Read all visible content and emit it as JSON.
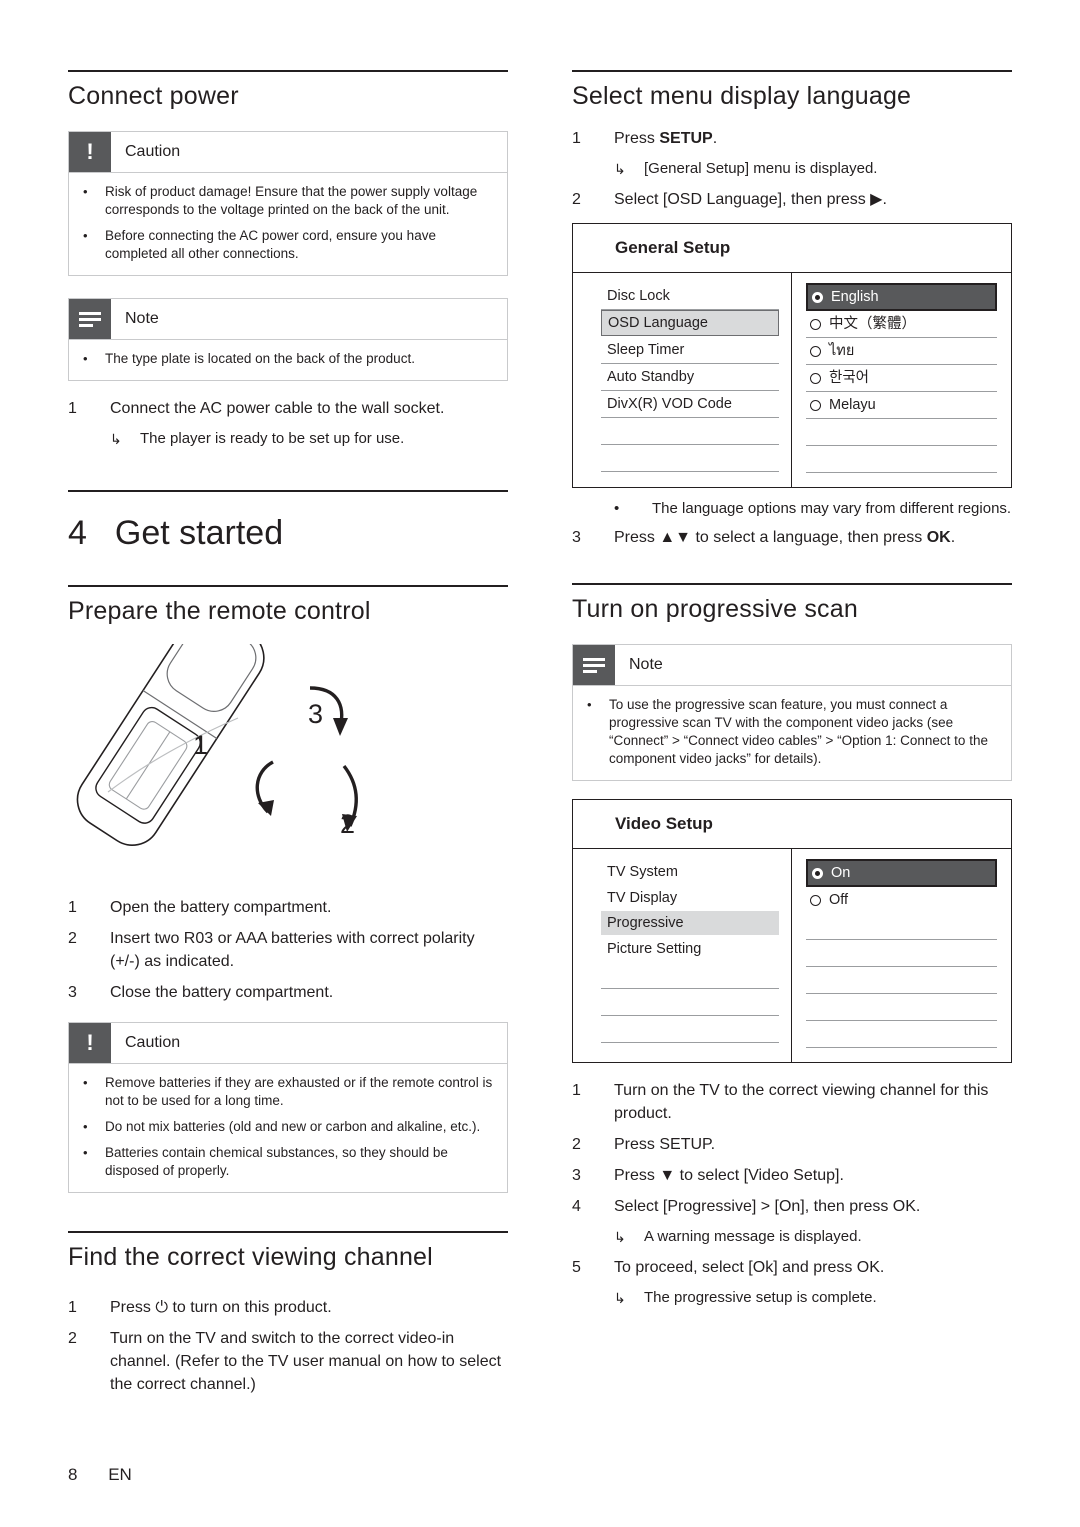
{
  "left": {
    "connect_power": {
      "title": "Connect power",
      "caution": {
        "label": "Caution",
        "bullets": [
          "Risk of product damage! Ensure that the power supply voltage corresponds to the voltage printed on the back of the unit.",
          "Before connecting the AC power cord, ensure you have completed all other connections."
        ]
      },
      "note": {
        "label": "Note",
        "bullets": [
          "The type plate is located on the back of the product."
        ]
      },
      "steps": [
        {
          "n": "1",
          "t": "Connect the AC power cable to the wall socket."
        }
      ],
      "substep": "The player is ready to be set up for use."
    },
    "chapter": {
      "num": "4",
      "title": "Get started"
    },
    "remote": {
      "title": "Prepare the remote control",
      "callouts": [
        "1",
        "2",
        "3"
      ],
      "steps": [
        {
          "n": "1",
          "t": "Open the battery compartment."
        },
        {
          "n": "2",
          "t": "Insert two R03 or AAA batteries with correct polarity (+/-) as indicated."
        },
        {
          "n": "3",
          "t": "Close the battery compartment."
        }
      ],
      "caution": {
        "label": "Caution",
        "bullets": [
          "Remove batteries if they are exhausted or if the remote control is not to be used for a long time.",
          "Do not mix batteries (old and new or carbon and alkaline, etc.).",
          "Batteries contain chemical substances, so they should be disposed of properly."
        ]
      }
    },
    "find_channel": {
      "title": "Find the correct viewing channel",
      "steps": [
        {
          "n": "1",
          "t": "Press ⏻ to turn on this product."
        },
        {
          "n": "2",
          "t": "Turn on the TV and switch to the correct video-in channel. (Refer to the TV user manual on how to select the correct channel.)"
        }
      ]
    }
  },
  "right": {
    "menu_lang": {
      "title": "Select menu display language",
      "step1_pre": "Press ",
      "step1_kw": "SETUP",
      "step1_post": ".",
      "sub1": "[General Setup] menu is displayed.",
      "step2": "Select [OSD Language], then press ▶.",
      "osd": {
        "title": "General Setup",
        "left_items": [
          "Disc Lock",
          "OSD Language",
          "Sleep Timer",
          "Auto Standby",
          "DivX(R) VOD Code"
        ],
        "left_selected_index": 1,
        "right_options": [
          "English",
          "中文（繁體）",
          "ไทย",
          "한국어",
          "Melayu"
        ],
        "right_selected_index": 0
      },
      "note_bullet": "The language options may vary from different regions.",
      "step3_pre": "Press ▲▼ to select a language, then press ",
      "step3_kw": "OK",
      "step3_post": "."
    },
    "progressive": {
      "title": "Turn on progressive scan",
      "note": {
        "label": "Note",
        "bullets": [
          "To use the progressive scan feature, you must connect a progressive scan TV with the component video jacks (see “Connect” > “Connect video cables” > “Option 1: Connect to the component video jacks” for details)."
        ]
      },
      "osd": {
        "title": "Video Setup",
        "left_items": [
          "TV System",
          "TV Display",
          "Progressive",
          "Picture Setting"
        ],
        "left_selected_index": 2,
        "right_options": [
          "On",
          "Off"
        ],
        "right_selected_index": 0
      },
      "steps": [
        {
          "n": "1",
          "t": "Turn on the TV to the correct viewing channel for this product."
        },
        {
          "n": "2",
          "t": "Press SETUP."
        },
        {
          "n": "3",
          "t": "Press ▼ to select [Video Setup]."
        },
        {
          "n": "4",
          "t": "Select [Progressive] > [On], then press OK."
        },
        {
          "n": "5",
          "t": "To proceed, select [Ok] and press OK."
        }
      ],
      "sub4": "A warning message is displayed.",
      "sub5": "The progressive setup is complete."
    }
  },
  "footer": {
    "page": "8",
    "lang": "EN"
  }
}
